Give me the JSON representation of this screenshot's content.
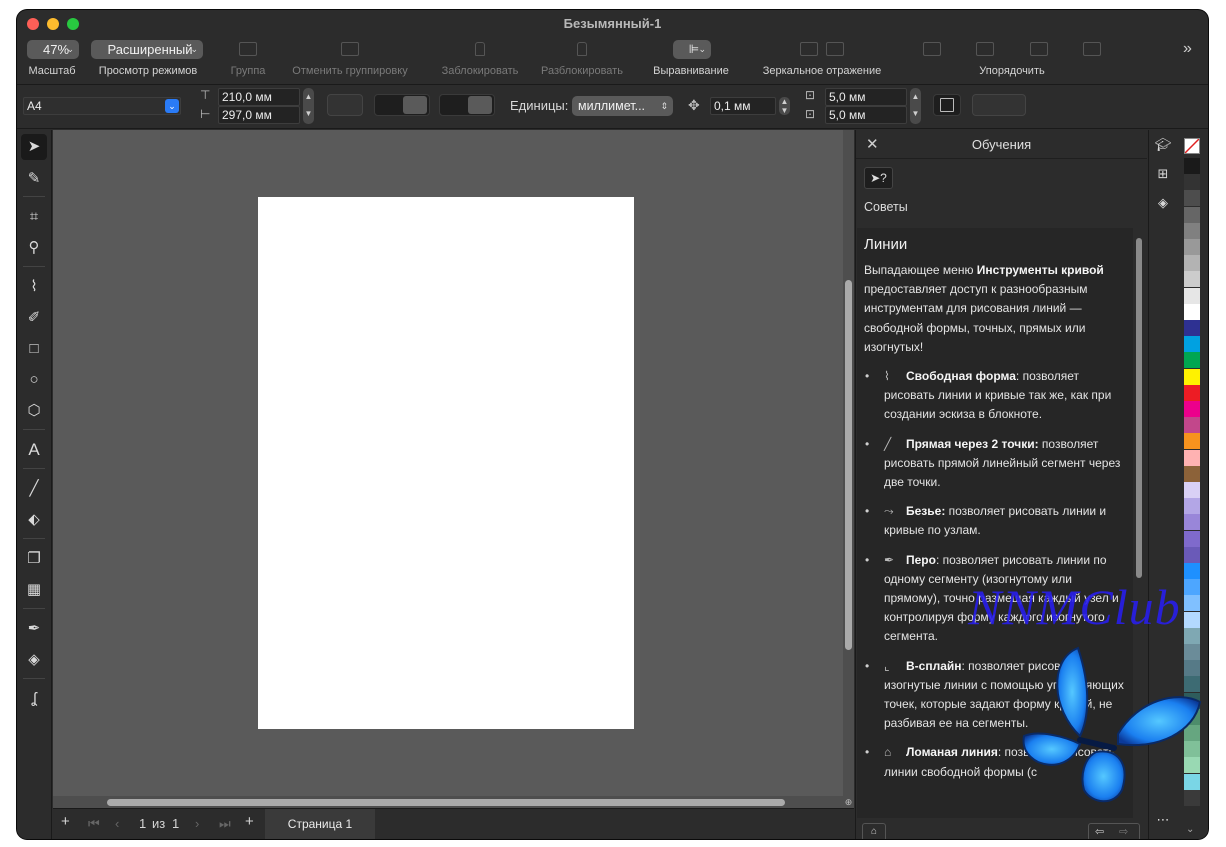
{
  "window": {
    "title": "Безымянный-1"
  },
  "toolbar": {
    "zoom": {
      "value": "47%",
      "caption": "Масштаб"
    },
    "view_mode": {
      "value": "Расширенный",
      "caption": "Просмотр режимов"
    },
    "group_label": "Группа",
    "ungroup_label": "Отменить группировку",
    "lock_label": "Заблокировать",
    "unlock_label": "Разблокировать",
    "align_label": "Выравнивание",
    "mirror_label": "Зеркальное отражение",
    "arrange_label": "Упорядочить",
    "more_icon": "chevrons-right-icon"
  },
  "property_bar": {
    "page_size": "A4",
    "width": "210,0 мм",
    "height": "297,0 мм",
    "units_label": "Единицы:",
    "units_value": "миллимет...",
    "nudge": "0,1 мм",
    "duplicate_x": "5,0 мм",
    "duplicate_y": "5,0 мм"
  },
  "page_nav": {
    "current": "1",
    "of": "из",
    "total": "1",
    "tab": "Страница 1"
  },
  "docker": {
    "title": "Обучения",
    "subtitle": "Советы",
    "heading": "Линии",
    "intro_pre": "Выпадающее меню ",
    "intro_bold": "Инструменты кривой",
    "intro_post": " предоставляет доступ к разнообразным инструментам для рисования линий — свободной формы, точных, прямых или изогнутых!",
    "items": [
      {
        "title": "Свободная форма",
        "text": ": позволяет рисовать линии и кривые так же, как при создании эскиза в блокноте."
      },
      {
        "title": "Прямая через 2 точки:",
        "text": " позволяет рисовать прямой линейный сегмент через две точки."
      },
      {
        "title": "Безье:",
        "text": " позволяет рисовать линии и кривые по узлам."
      },
      {
        "title": "Перо",
        "text": ": позволяет рисовать линии по одному сегменту (изогнутому или прямому), точно размещая каждый узел и контролируя форму каждого изогнутого сегмента."
      },
      {
        "title": "В-сплайн",
        "text": ": позволяет рисовать изогнутые линии с помощью управляющих точек, которые задают форму кривой, не разбивая ее на сегменты."
      },
      {
        "title": "Ломаная линия",
        "text": ": позволяет рисовать линии свободной формы (с"
      }
    ]
  },
  "watermark": {
    "text": "NNMClub"
  },
  "colors": {
    "accent": "#2a7bf6",
    "window_bg": "#2c2c2c",
    "canvas_bg": "#5a5a5a",
    "page_bg": "#ffffff",
    "palette": [
      "#1a1a1a",
      "#333333",
      "#4d4d4d",
      "#666666",
      "#808080",
      "#999999",
      "#b3b3b3",
      "#cccccc",
      "#e6e6e6",
      "#ffffff",
      "#2e3192",
      "#00a1e1",
      "#00a651",
      "#fff200",
      "#ed1c24",
      "#ec008c",
      "#c2478b",
      "#f7931e",
      "#ffb2b2",
      "#8c6239",
      "#d9d0f5",
      "#b3a6e6",
      "#9986d9",
      "#7f6acc",
      "#6a5ab8",
      "#1e90ff",
      "#4da6ff",
      "#80c0ff",
      "#b3d9ff",
      "#7fa8b3",
      "#6b8c99",
      "#567a87",
      "#3d6b73",
      "#2e5c5c",
      "#4d8c6b",
      "#66a680",
      "#80c099",
      "#99d9b3",
      "#7ad6e6",
      "#3a3a3a"
    ]
  }
}
